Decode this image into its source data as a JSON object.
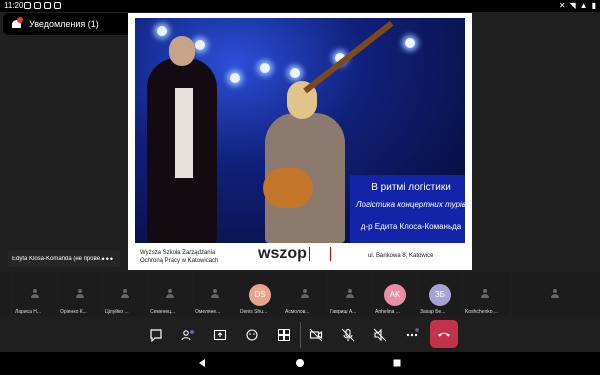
{
  "status_bar": {
    "time": "11:20"
  },
  "notification": {
    "label": "Уведомления (1)"
  },
  "slide": {
    "title": "В ритмі логістики",
    "subtitle": "Логістика концертних турів",
    "author": "д-р Едита Клоса-Команьда",
    "school_line1": "Wyższa Szkoła Zarządzania",
    "school_line2": "Ochroną Pracy w Katowicach",
    "logo": "wszop",
    "address": "ul. Bankowa 8, Katowice"
  },
  "presenter_chip": {
    "name": "Edyta Klosa-Komańda (не прове...",
    "more": "•••"
  },
  "participants": [
    {
      "name": "",
      "initials": ""
    },
    {
      "name": "Лариса Н...",
      "initials": ""
    },
    {
      "name": "Оріенко К...",
      "initials": ""
    },
    {
      "name": "Цілуйко ...",
      "initials": ""
    },
    {
      "name": "Семенец...",
      "initials": ""
    },
    {
      "name": "Омеляне...",
      "initials": ""
    },
    {
      "name": "Denis Shu...",
      "initials": "DS",
      "color": "#e8a58e"
    },
    {
      "name": "Асмолов...",
      "initials": ""
    },
    {
      "name": "Гавриш А...",
      "initials": ""
    },
    {
      "name": "Anhelina ...",
      "initials": "AK",
      "color": "#e98ea4"
    },
    {
      "name": "Захар Бе...",
      "initials": "ЗБ",
      "color": "#a8a2d4"
    },
    {
      "name": "Koshchenko ...",
      "initials": ""
    }
  ],
  "toolbar": {
    "buttons": [
      "chat-icon",
      "people-icon",
      "share-icon",
      "reactions-icon",
      "layout-icon",
      "camera-off-icon",
      "mic-off-icon",
      "speaker-off-icon",
      "more-icon",
      "hangup-icon"
    ]
  },
  "colors": {
    "accent": "#c4314b",
    "slide_title_bg": "#1424a8"
  }
}
